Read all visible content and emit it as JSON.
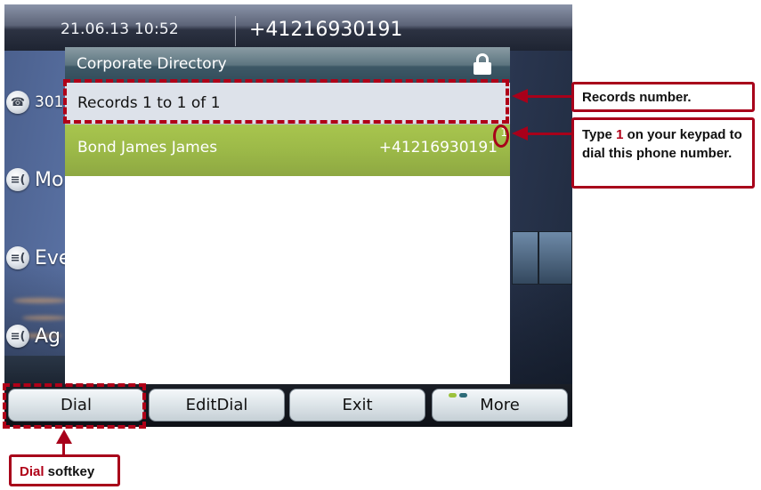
{
  "status_bar": {
    "datetime": "21.06.13 10:52",
    "line_number": "+41216930191"
  },
  "line_keys": [
    {
      "icon": "handset-icon",
      "label": "301"
    },
    {
      "icon": "speed-dial-icon",
      "label": "Mo"
    },
    {
      "icon": "speed-dial-icon",
      "label": "Eve"
    },
    {
      "icon": "speed-dial-icon",
      "label": "Ag"
    }
  ],
  "directory": {
    "title": "Corporate Directory",
    "lock_icon": "lock-icon",
    "records_text": "Records 1 to 1 of 1",
    "entries": [
      {
        "index": "1",
        "name": "Bond James James",
        "number": "+41216930191"
      }
    ]
  },
  "softkeys": [
    {
      "label": "Dial"
    },
    {
      "label": "EditDial"
    },
    {
      "label": "Exit"
    },
    {
      "label": "More",
      "indicator_colors": [
        "#9cc23c",
        "#2d6b78"
      ]
    }
  ],
  "annotations": {
    "records_callout": "Records number.",
    "dial_hint_prefix": "Type ",
    "dial_hint_key": "1",
    "dial_hint_suffix": " on your keypad to dial this phone number.",
    "softkey_callout_key": "Dial",
    "softkey_callout_suffix": " softkey",
    "accent_color": "#b00018"
  }
}
